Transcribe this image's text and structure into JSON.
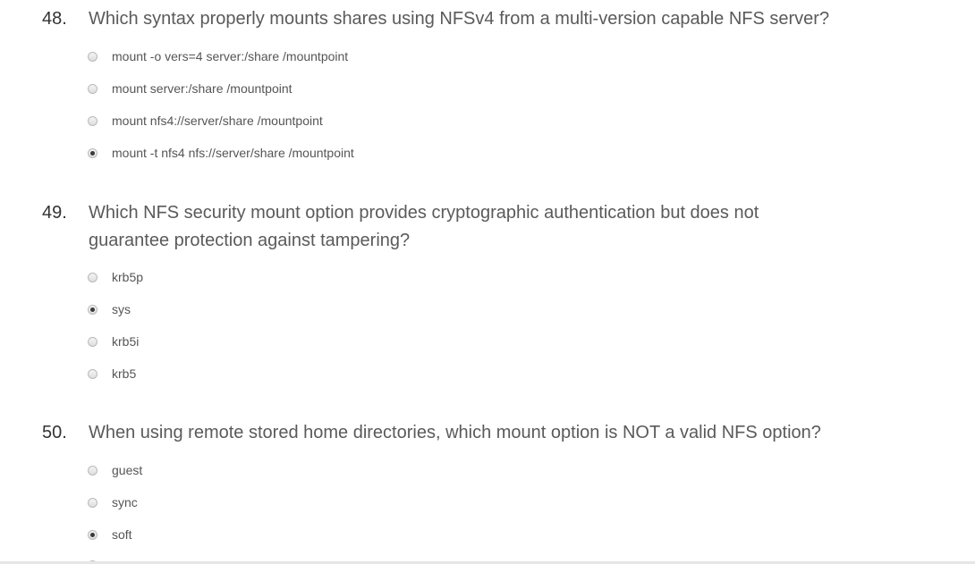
{
  "questions": [
    {
      "number": "48.",
      "text": "Which syntax properly mounts shares using NFSv4 from a multi-version capable NFS server?",
      "options": [
        {
          "label": "mount -o vers=4 server:/share /mountpoint",
          "selected": false
        },
        {
          "label": "mount server:/share /mountpoint",
          "selected": false
        },
        {
          "label": "mount nfs4://server/share /mountpoint",
          "selected": false
        },
        {
          "label": "mount -t nfs4 nfs://server/share /mountpoint",
          "selected": true
        }
      ]
    },
    {
      "number": "49.",
      "text": "Which NFS security mount option provides cryptographic authentication but does not guarantee protection against tampering?",
      "options": [
        {
          "label": "krb5p",
          "selected": false
        },
        {
          "label": "sys",
          "selected": true
        },
        {
          "label": "krb5i",
          "selected": false
        },
        {
          "label": "krb5",
          "selected": false
        }
      ]
    },
    {
      "number": "50.",
      "text": "When using remote stored home directories, which mount option is NOT a valid NFS option?",
      "options": [
        {
          "label": "guest",
          "selected": false
        },
        {
          "label": "sync",
          "selected": false
        },
        {
          "label": "soft",
          "selected": true
        }
      ]
    }
  ]
}
